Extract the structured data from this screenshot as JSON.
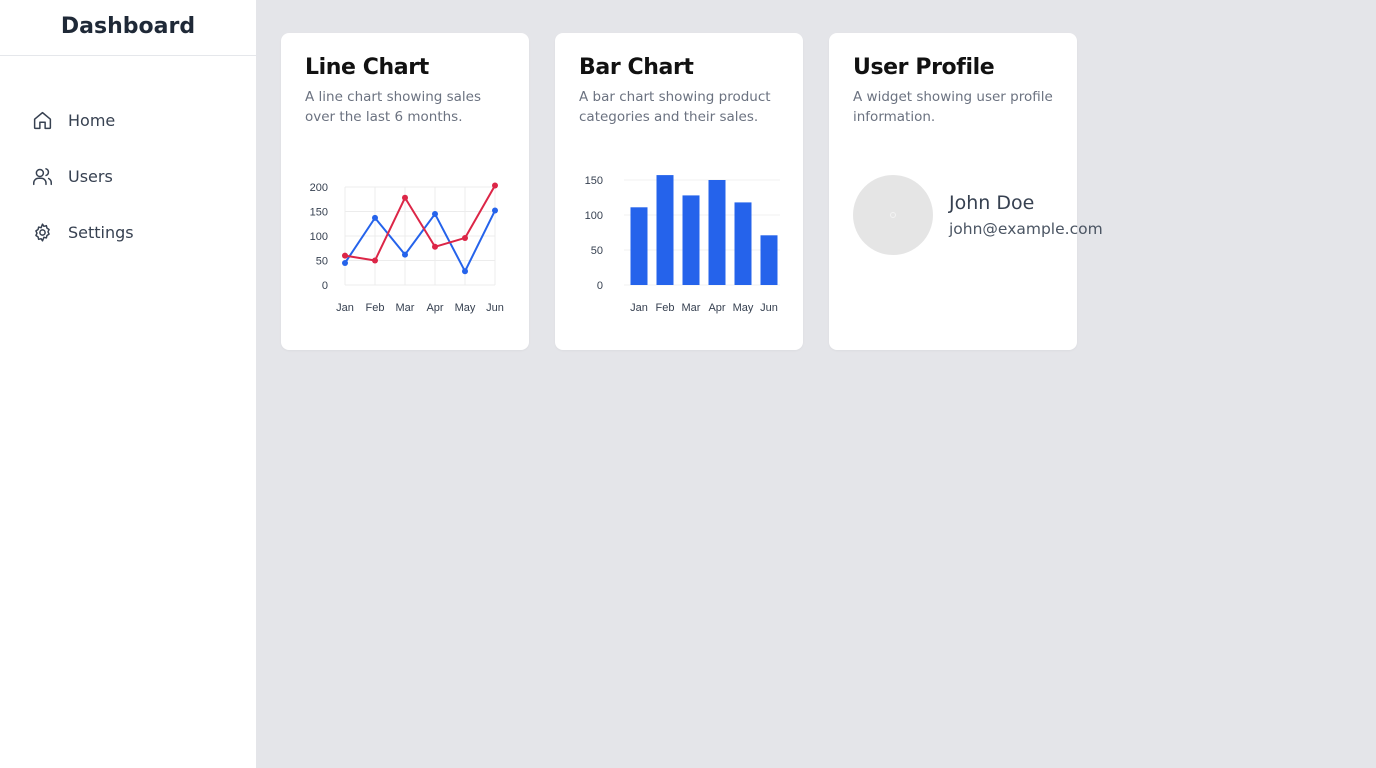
{
  "sidebar": {
    "title": "Dashboard",
    "items": [
      {
        "label": "Home",
        "icon": "home-icon"
      },
      {
        "label": "Users",
        "icon": "users-icon"
      },
      {
        "label": "Settings",
        "icon": "gear-icon"
      }
    ]
  },
  "cards": {
    "line": {
      "title": "Line Chart",
      "description": "A line chart showing sales over the last 6 months."
    },
    "bar": {
      "title": "Bar Chart",
      "description": "A bar chart showing product categories and their sales."
    },
    "profile": {
      "title": "User Profile",
      "description": "A widget showing user profile information.",
      "name": "John Doe",
      "email": "john@example.com"
    }
  },
  "colors": {
    "blue": "#2563eb",
    "red": "#dc2647",
    "grid": "#ececec"
  },
  "chart_data": [
    {
      "type": "line",
      "categories": [
        "Jan",
        "Feb",
        "Mar",
        "Apr",
        "May",
        "Jun"
      ],
      "yticks": [
        0,
        50,
        100,
        150,
        200
      ],
      "ylim": [
        0,
        200
      ],
      "grid": true,
      "series": [
        {
          "color": "#2563eb",
          "values": [
            45,
            137,
            62,
            145,
            28,
            152
          ]
        },
        {
          "color": "#dc2647",
          "values": [
            60,
            50,
            178,
            78,
            96,
            203
          ]
        }
      ]
    },
    {
      "type": "bar",
      "categories": [
        "Jan",
        "Feb",
        "Mar",
        "Apr",
        "May",
        "Jun"
      ],
      "yticks": [
        0,
        50,
        100,
        150
      ],
      "ylim": [
        0,
        150
      ],
      "grid": true,
      "values": [
        111,
        157,
        128,
        150,
        118,
        71
      ],
      "color": "#2563eb"
    }
  ]
}
